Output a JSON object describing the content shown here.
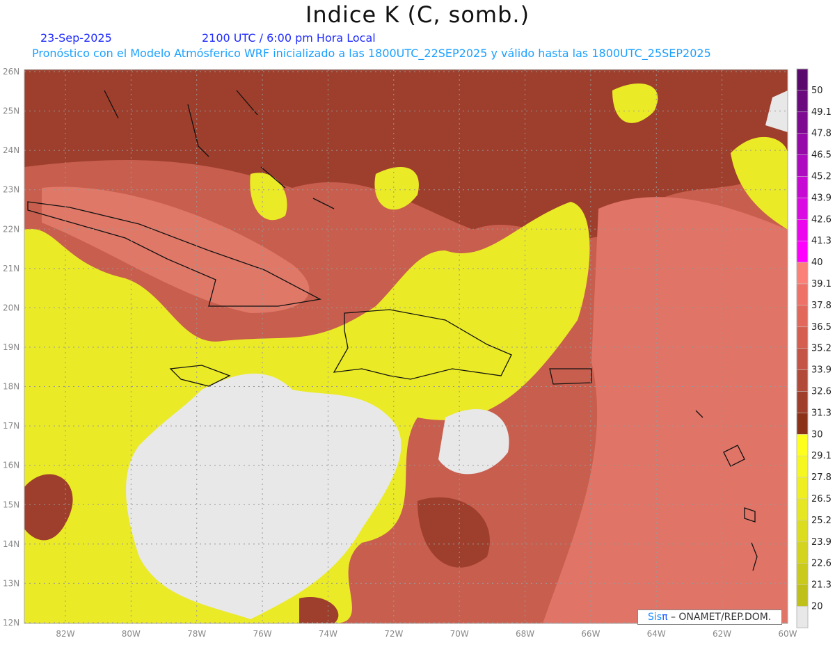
{
  "header": {
    "title": "Indice K (C, somb.)",
    "date": "23-Sep-2025",
    "time": "2100 UTC / 6:00 pm Hora Local",
    "subtitle": "Pronóstico con el Modelo Atmósferico WRF inicializado a las 1800UTC_22SEP2025 y válido hasta las  1800UTC_25SEP2025"
  },
  "axes": {
    "lon_labels": [
      "82W",
      "80W",
      "78W",
      "76W",
      "74W",
      "72W",
      "70W",
      "68W",
      "66W",
      "64W",
      "62W",
      "60W"
    ],
    "lat_labels": [
      "26N",
      "25N",
      "24N",
      "23N",
      "22N",
      "21N",
      "20N",
      "19N",
      "18N",
      "17N",
      "16N",
      "15N",
      "14N",
      "13N",
      "12N"
    ]
  },
  "legend": {
    "labels": [
      "50",
      "49.1",
      "47.8",
      "46.5",
      "45.2",
      "43.9",
      "42.6",
      "41.3",
      "40",
      "39.1",
      "37.8",
      "36.5",
      "35.2",
      "33.9",
      "32.6",
      "31.3",
      "30",
      "29.1",
      "27.8",
      "26.5",
      "25.2",
      "23.9",
      "22.6",
      "21.3",
      "20"
    ],
    "colors": [
      "#5a0a6c",
      "#6a0a7e",
      "#7e0a92",
      "#960aaa",
      "#ae0ac0",
      "#c60ad4",
      "#da0ae2",
      "#ec06ee",
      "#ff00ff",
      "#fa8078",
      "#ee7268",
      "#e2685c",
      "#d45e50",
      "#c65446",
      "#b24a3a",
      "#a03e2c",
      "#8c3218",
      "#ffff1e",
      "#f6f620",
      "#eeee22",
      "#e6e622",
      "#dcdc20",
      "#d4d41e",
      "#caca1c",
      "#c0c01a",
      "#e8e8e8"
    ]
  },
  "credit": {
    "brand": "Sis",
    "pi": "π",
    "text": " –  ONAMET/REP.DOM."
  }
}
